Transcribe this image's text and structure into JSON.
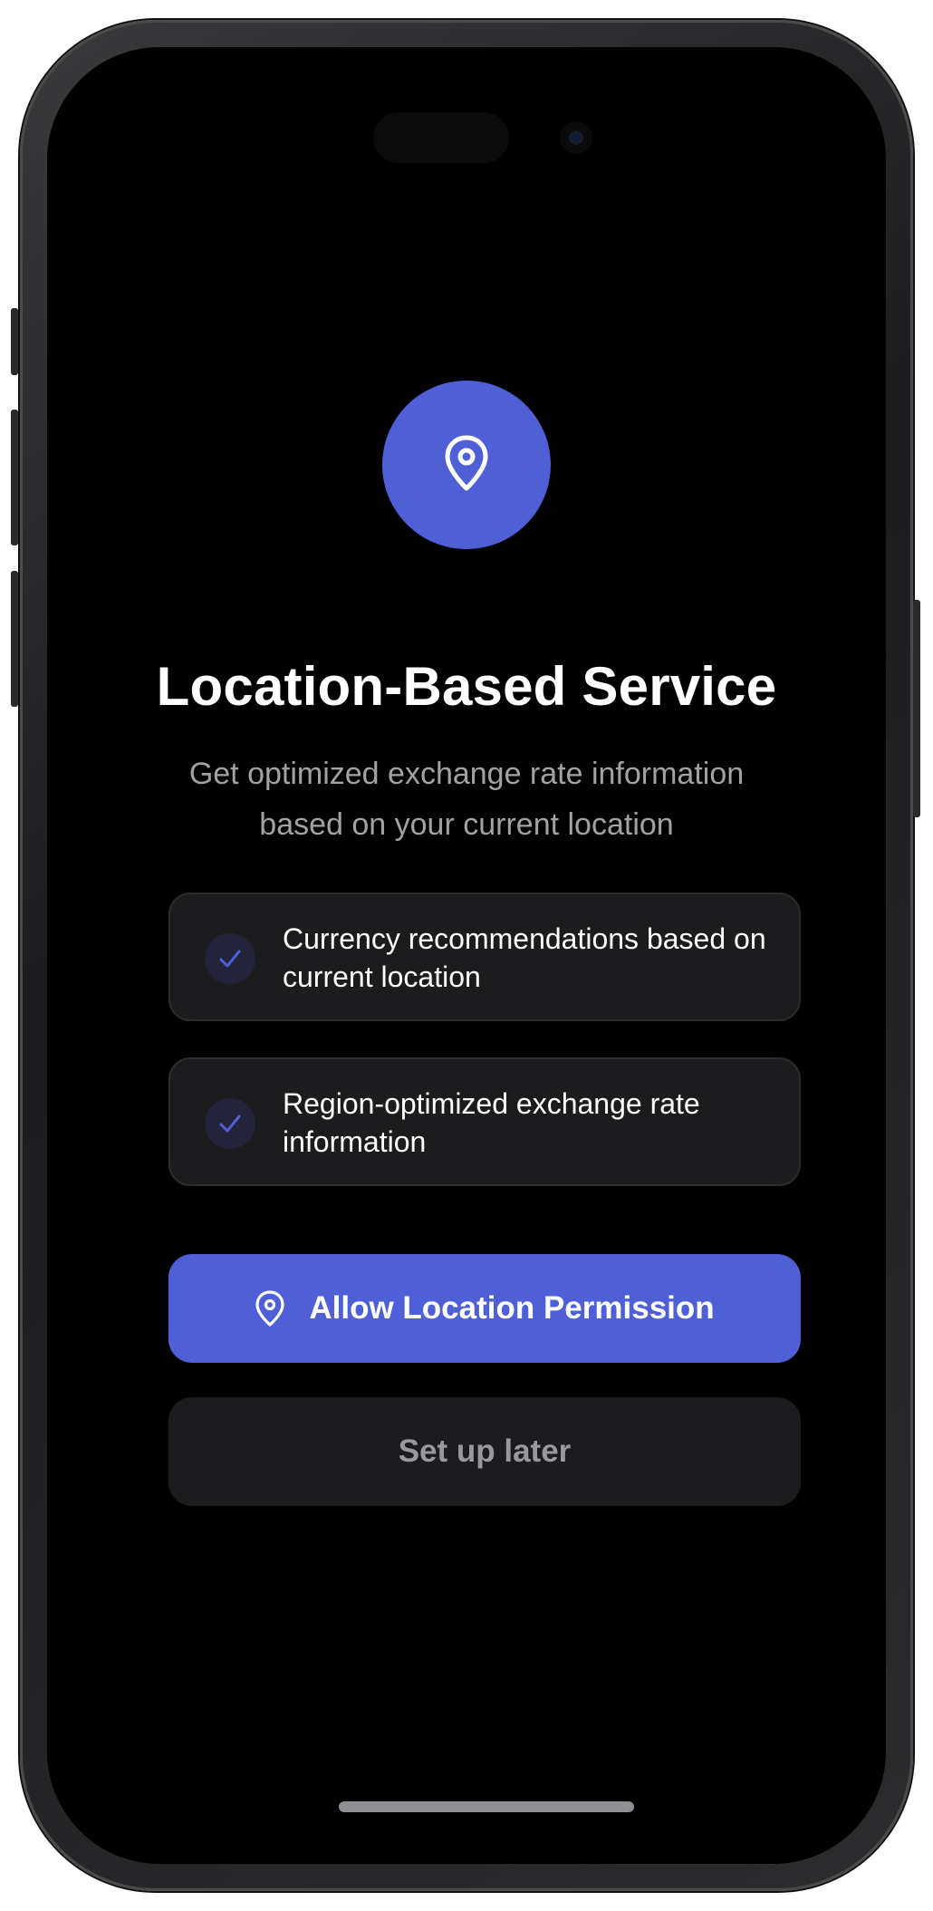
{
  "screen": {
    "title": "Location-Based Service",
    "subtitle": "Get optimized exchange rate information based on your current location",
    "hero_icon": "map-pin-icon"
  },
  "features": [
    {
      "icon": "check-icon",
      "text": "Currency recommendations based on current location"
    },
    {
      "icon": "check-icon",
      "text": "Region-optimized exchange rate information"
    }
  ],
  "actions": {
    "allow_label": "Allow Location Permission",
    "allow_icon": "map-pin-icon",
    "later_label": "Set up later"
  },
  "colors": {
    "accent": "#4f5fd6",
    "background": "#000000",
    "card": "#1c1c1e",
    "subtitle_text": "#a1a1a6",
    "secondary_text": "#98989d"
  }
}
